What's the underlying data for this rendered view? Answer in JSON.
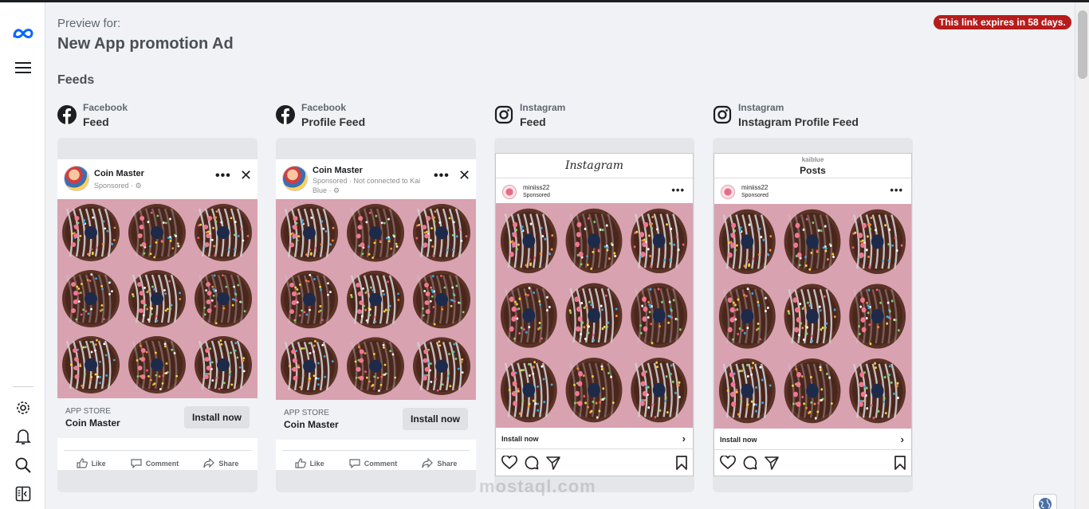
{
  "header": {
    "preview_for": "Preview for:",
    "ad_title": "New App promotion Ad",
    "expires": "This link expires in 58 days."
  },
  "section_heading": "Feeds",
  "sidebar": {
    "icons": [
      "meta-logo-icon",
      "menu-icon",
      "gear-icon",
      "bell-icon",
      "search-icon",
      "panel-toggle-icon"
    ]
  },
  "placements": [
    {
      "platform": "Facebook",
      "placement": "Feed",
      "icon": "facebook-icon"
    },
    {
      "platform": "Facebook",
      "placement": "Profile Feed",
      "icon": "facebook-icon"
    },
    {
      "platform": "Instagram",
      "placement": "Feed",
      "icon": "instagram-icon"
    },
    {
      "platform": "Instagram",
      "placement": "Instagram Profile Feed",
      "icon": "instagram-icon"
    }
  ],
  "fb_feed": {
    "page_name": "Coin Master",
    "sponsored": "Sponsored · ⚙",
    "cta_source": "APP STORE",
    "cta_app": "Coin Master",
    "cta_button": "Install now",
    "actions": [
      "Like",
      "Comment",
      "Share"
    ]
  },
  "fb_profile": {
    "page_name": "Coin Master",
    "sponsored": "Sponsored · Not connected to Kai Blue · ⚙",
    "cta_source": "APP STORE",
    "cta_app": "Coin Master",
    "cta_button": "Install now",
    "actions": [
      "Like",
      "Comment",
      "Share"
    ]
  },
  "ig_feed": {
    "logo": "Instagram",
    "username": "miniiss22",
    "sponsored": "Sponsored",
    "install": "Install now"
  },
  "ig_profile": {
    "profile_user": "kaiblue",
    "title": "Posts",
    "username": "miniiss22",
    "sponsored": "Sponsored",
    "install": "Install now"
  },
  "watermark": "mostaql.com",
  "colors": {
    "expires_bg": "#b71c1c",
    "image_bg": "#d8a2b0",
    "page_bg": "#f0f2f5"
  }
}
